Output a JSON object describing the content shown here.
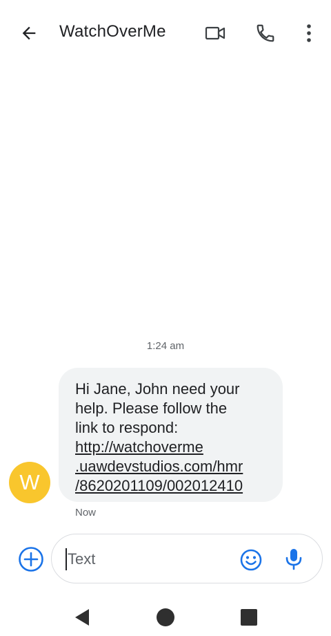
{
  "app_bar": {
    "title": "WatchOverMe",
    "icons": {
      "back": "arrow-back-icon",
      "video": "videocam-icon",
      "call": "phone-icon",
      "more": "more-vert-icon"
    }
  },
  "conversation": {
    "timestamp": "1:24 am",
    "message": {
      "sender_initial": "W",
      "avatar_color": "#f9c62d",
      "text_lines": [
        "Hi Jane, John need your",
        "help. Please follow the",
        "link to respond:"
      ],
      "link_lines": [
        "http://watchoverme",
        ".uawdevstudios.com/hmr",
        "/8620201109/002012410"
      ],
      "status": "Now"
    }
  },
  "compose": {
    "placeholder": "Text",
    "accent_color": "#1a73e8",
    "icons": {
      "attach": "add-circle-icon",
      "emoji": "emoji-icon",
      "mic": "mic-icon"
    }
  },
  "nav_bar": {
    "icons": {
      "back": "triangle-back-icon",
      "home": "circle-home-icon",
      "recent": "square-recents-icon"
    }
  }
}
